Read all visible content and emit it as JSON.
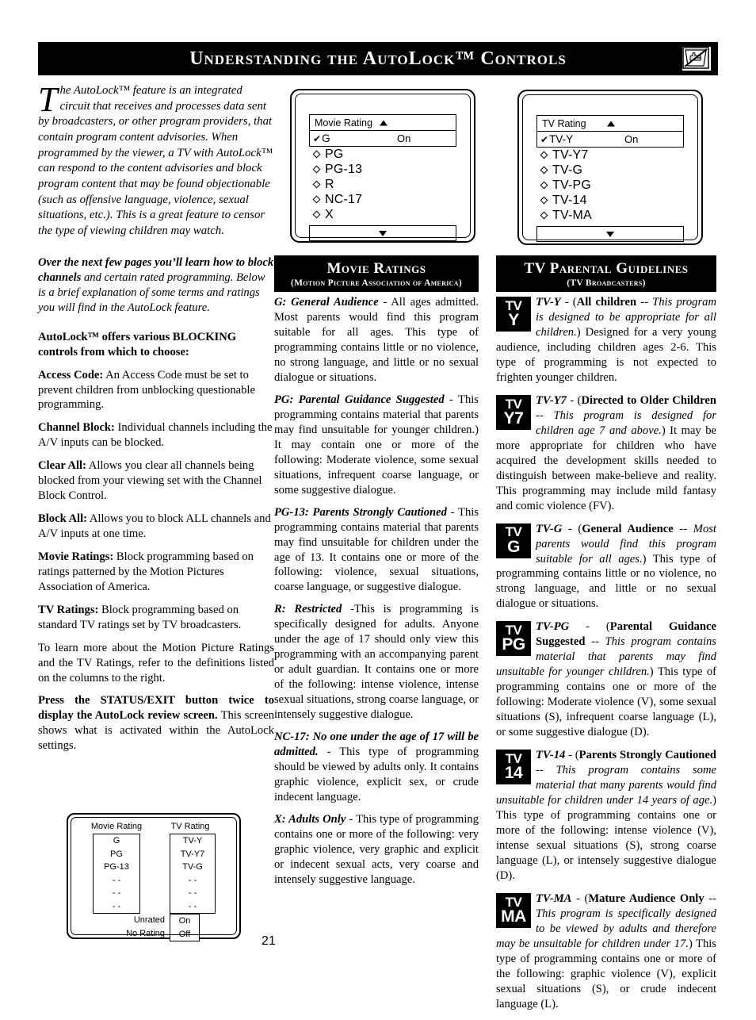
{
  "header": {
    "title": "Understanding the AutoLock™ Controls",
    "icon": "tv-no-hand-icon"
  },
  "page_number": "21",
  "left_column": {
    "intro_dropcap": "T",
    "intro_text": "he AutoLock™ feature is an integrated circuit that receives and processes data sent by broadcasters, or other program providers, that contain program content advisories. When programmed by the viewer, a TV with AutoLock™ can respond to the content advisories and block program content that may be found objectionable (such as offensive language, violence, sexual situations, etc.). This is a great feature to censor the type of viewing children may watch.",
    "para2_bold": "Over the next few pages you’ll learn how to block channels",
    "para2_rest": " and certain rated programming. Below is a brief explanation of some terms and ratings you will find in the AutoLock feature.",
    "blocking_heading": "AutoLock™ offers various BLOCKING controls from which to choose:",
    "definitions": [
      {
        "term": "Access Code:",
        "text": " An Access Code must be set to prevent children from unblocking questionable programming."
      },
      {
        "term": "Channel Block:",
        "text": " Individual channels including the A/V inputs can be blocked."
      },
      {
        "term": "Clear All:",
        "text": " Allows you clear all channels being blocked from your viewing set with the Channel Block Control."
      },
      {
        "term": "Block All:",
        "text": " Allows you to block ALL channels and A/V inputs at one time."
      },
      {
        "term": "Movie Ratings:",
        "text": " Block programming based on ratings patterned by the Motion Pictures Association of America."
      },
      {
        "term": "TV Ratings:",
        "text": " Block programming based on standard TV ratings set by TV broadcasters."
      }
    ],
    "learn_more": "To learn more about the Motion Picture Ratings and the TV Ratings, refer to the definitions listed on the columns to the right.",
    "status_bold": "Press the STATUS/EXIT button twice to display the AutoLock review screen.",
    "status_rest": " This screen shows what is activated within the AutoLock settings."
  },
  "osd_movie": {
    "title": "Movie Rating",
    "up_arrow": "▲",
    "down_arrow": "▼",
    "selected_check": "✔",
    "selected_label": "G",
    "selected_value": "On",
    "items": [
      "PG",
      "PG-13",
      "R",
      "NC-17",
      "X"
    ]
  },
  "osd_tv": {
    "title": "TV Rating",
    "up_arrow": "▲",
    "down_arrow": "▼",
    "selected_check": "✔",
    "selected_label": "TV-Y",
    "selected_value": "On",
    "items": [
      "TV-Y7",
      "TV-G",
      "TV-PG",
      "TV-14",
      "TV-MA"
    ]
  },
  "review_screen": {
    "movie_label": "Movie Rating",
    "tv_label": "TV Rating",
    "movie_values": [
      "G",
      "PG",
      "PG-13",
      "- -",
      "- -",
      "- -"
    ],
    "tv_values": [
      "TV-Y",
      "TV-Y7",
      "TV-G",
      "- -",
      "- -",
      "- -"
    ],
    "unrated_label": "Unrated",
    "unrated_value": "On",
    "norating_label": "No Rating",
    "norating_value": "Off"
  },
  "movie_ratings_section": {
    "heading_line1": "Movie Ratings",
    "heading_line2": "(Motion Picture Association of America)",
    "entries": [
      {
        "term": "G: General Audience",
        "body": " - All ages admitted. Most parents would find this program suitable for all ages. This type of programming contains little or no violence, no strong language, and little or no sexual dialogue or situations."
      },
      {
        "term": "PG: Parental Guidance Suggested",
        "body": " - This programming contains material that parents may find unsuitable for younger children.) It may contain one or more of the following: Moderate violence, some sexual situations, infrequent coarse language, or some suggestive dialogue."
      },
      {
        "term": "PG-13: Parents Strongly Cautioned",
        "body": " - This programming contains material that parents may find unsuitable for children under the age of 13. It contains one or more of the following: violence, sexual situations, coarse language, or suggestive dialogue."
      },
      {
        "term": "R: Restricted",
        "body": " -This is programming is specifically designed for adults.  Anyone under the age of 17 should only view this programming with an accompanying parent or adult guardian. It contains one or more of the following: intense violence, intense sexual situations, strong coarse language, or intensely suggestive dialogue."
      },
      {
        "term": "NC-17: No one under the age of 17 will be admitted.",
        "body": " - This type of programming should be viewed by adults only. It contains graphic violence, explicit sex, or crude indecent language."
      },
      {
        "term": "X: Adults Only",
        "body": " - This type of programming contains one or more of the following: very graphic violence, very graphic and explicit or indecent sexual acts, very coarse and intensely suggestive language."
      }
    ]
  },
  "tv_guidelines_section": {
    "heading_line1": "TV Parental Guidelines",
    "heading_line2": "(TV Broadcasters)",
    "entries": [
      {
        "glyph_top": "TV",
        "glyph_bottom": "Y",
        "code": "TV-Y",
        "sep": " - (",
        "bold_name": "All children",
        "italic_note": " -- This program is designed to be appropriate for all children.",
        "body": ") Designed for a very young audience, including children ages 2-6. This type of programming is not expected to frighten younger children."
      },
      {
        "glyph_top": "TV",
        "glyph_bottom": "Y7",
        "code": "TV-Y7",
        "sep": " - (",
        "bold_name": "Directed to Older Children",
        "italic_note": " -- This program is designed for children age 7 and above.",
        "body": ") It may be more appropriate for children who have acquired the development skills needed to distinguish between make-believe and reality. This programming may include mild fantasy and comic violence (FV)."
      },
      {
        "glyph_top": "TV",
        "glyph_bottom": "G",
        "code": "TV-G",
        "sep": " - (",
        "bold_name": "General Audience",
        "italic_note": " -- Most parents would find this program suitable for all ages.",
        "body": ") This type of programming contains little or no violence, no strong language, and little or no sexual dialogue or situations."
      },
      {
        "glyph_top": "TV",
        "glyph_bottom": "PG",
        "code": "TV-PG",
        "sep": " - (",
        "bold_name": "Parental Guidance Suggested",
        "italic_note": " -- This program contains material that parents may find unsuitable for younger children.",
        "body": ") This type of programming contains one or more of the following: Moderate violence (V), some sexual situations (S), infrequent coarse language (L), or some suggestive dialogue (D)."
      },
      {
        "glyph_top": "TV",
        "glyph_bottom": "14",
        "code": "TV-14",
        "sep": " - (",
        "bold_name": "Parents Strongly Cautioned",
        "italic_note": " -- This program contains some material that many parents would find unsuitable for children under 14 years of age.",
        "body": ") This type of programming contains one or more of the following: intense violence (V), intense sexual situations (S), strong coarse language (L), or intensely suggestive dialogue (D)."
      },
      {
        "glyph_top": "TV",
        "glyph_bottom": "MA",
        "code": "TV-MA",
        "sep": " - (",
        "bold_name": "Mature Audience Only",
        "italic_note": " -- This program is specifically designed to be viewed by adults and therefore may be unsuitable for children under 17.",
        "body": ") This type of programming contains one or more of the following: graphic violence (V), explicit sexual situations (S), or crude indecent language (L)."
      }
    ]
  },
  "colors": {
    "ink": "#000000",
    "paper": "#ffffff"
  }
}
